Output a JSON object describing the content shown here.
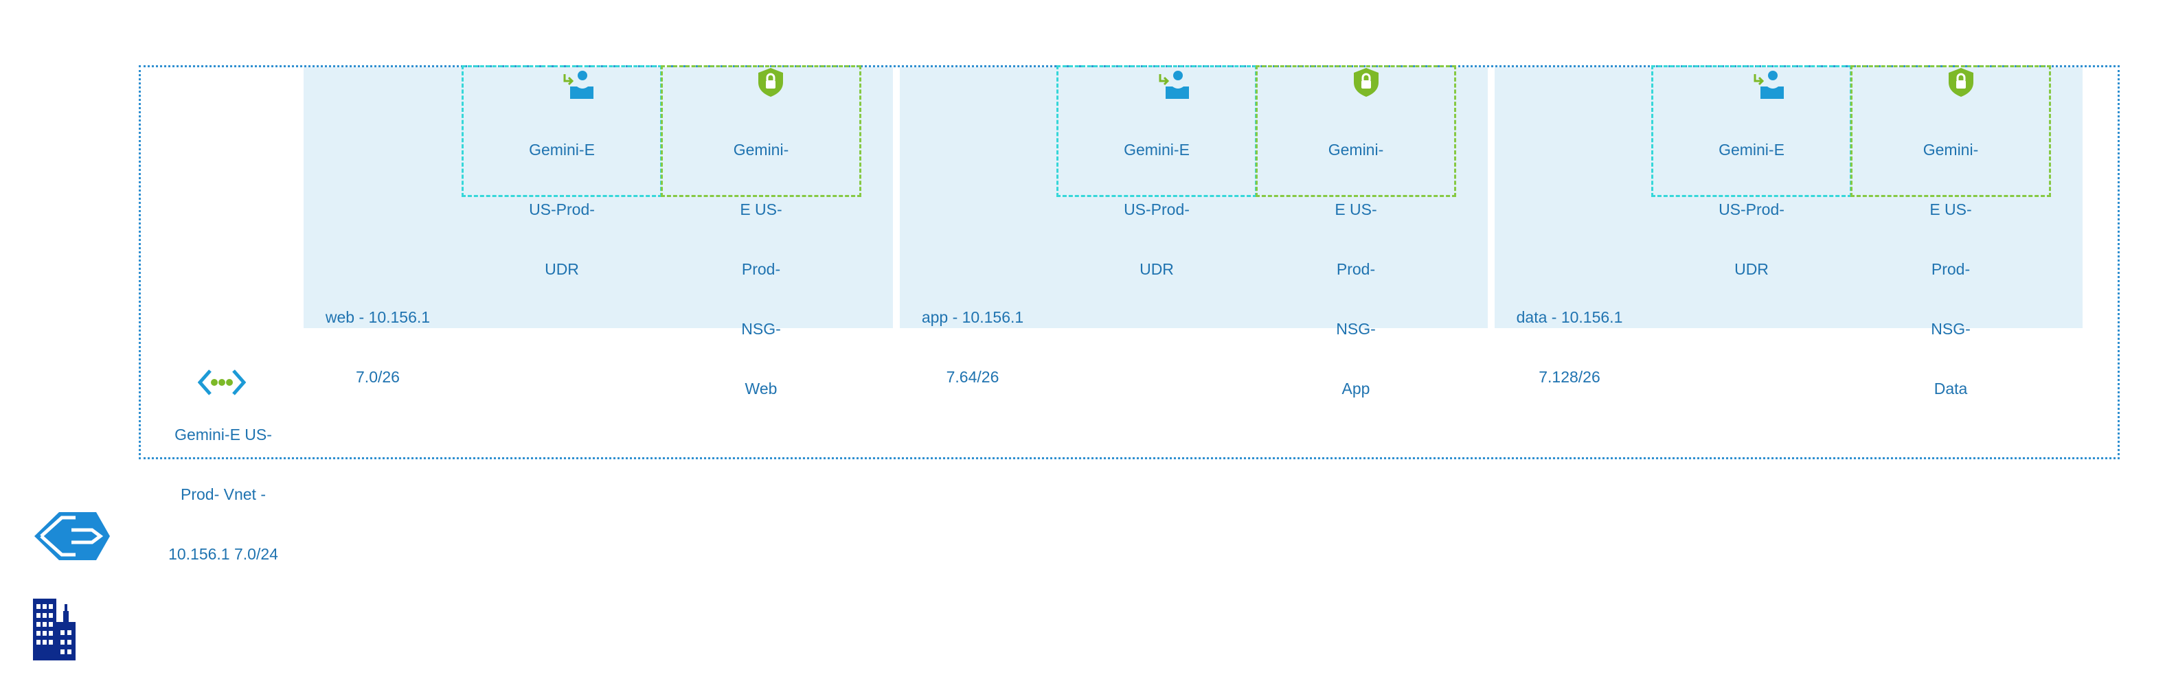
{
  "diagram": {
    "vnet": {
      "label_lines": [
        "Gemini-E US-",
        "Prod- Vnet -",
        "10.156.1 7.0/24"
      ],
      "icon": "virtual-network-icon"
    },
    "subnets": [
      {
        "id": "web",
        "label_lines": [
          "web - 10.156.1",
          "7.0/26"
        ],
        "udr": {
          "label_lines": [
            "Gemini-E",
            "US-Prod-",
            "UDR"
          ],
          "icon": "route-table-icon"
        },
        "nsg": {
          "label_lines": [
            "Gemini-",
            "E US-",
            "Prod-",
            "NSG-",
            "Web"
          ],
          "icon": "network-security-group-icon"
        }
      },
      {
        "id": "app",
        "label_lines": [
          "app - 10.156.1",
          "7.64/26"
        ],
        "udr": {
          "label_lines": [
            "Gemini-E",
            "US-Prod-",
            "UDR"
          ],
          "icon": "route-table-icon"
        },
        "nsg": {
          "label_lines": [
            "Gemini-",
            "E US-",
            "Prod-",
            "NSG-",
            "App"
          ],
          "icon": "network-security-group-icon"
        }
      },
      {
        "id": "data",
        "label_lines": [
          "data - 10.156.1",
          "7.128/26"
        ],
        "udr": {
          "label_lines": [
            "Gemini-E",
            "US-Prod-",
            "UDR"
          ],
          "icon": "route-table-icon"
        },
        "nsg": {
          "label_lines": [
            "Gemini-",
            "E US-",
            "Prod-",
            "NSG-",
            "Data"
          ],
          "icon": "network-security-group-icon"
        }
      }
    ],
    "legend_icons": [
      "expressroute-gateway-icon",
      "on-premises-building-icon"
    ],
    "colors": {
      "vnet_border": "#2f8fd0",
      "subnet_fill": "#e2f1f9",
      "udr_border": "#36d7d9",
      "nsg_border": "#86c943",
      "label_text": "#1f73b0",
      "icon_blue": "#1c9ad6",
      "icon_green": "#7db928",
      "building_navy": "#0d2b8c"
    }
  }
}
